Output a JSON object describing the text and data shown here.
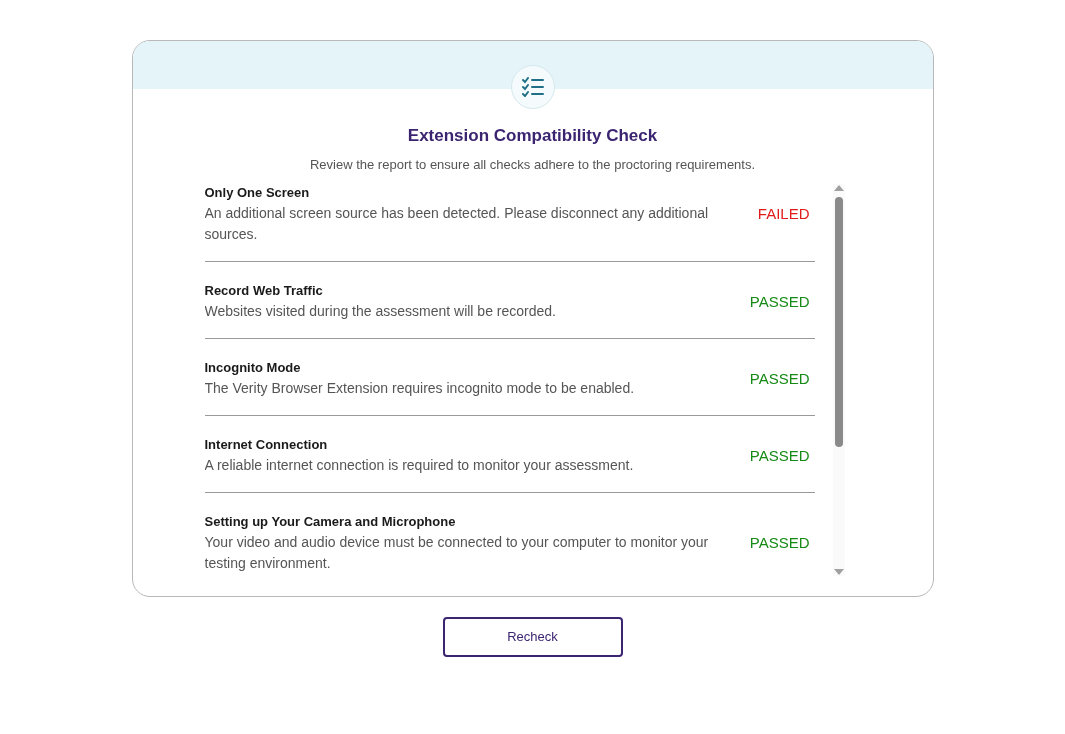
{
  "dialog": {
    "title": "Extension Compatibility Check",
    "subtitle": "Review the report to ensure all checks adhere to the proctoring requirements."
  },
  "checks": [
    {
      "title": "Only One Screen",
      "description": "An additional screen source has been detected. Please disconnect any additional sources.",
      "status": "FAILED",
      "passed": false
    },
    {
      "title": "Record Web Traffic",
      "description": "Websites visited during the assessment will be recorded.",
      "status": "PASSED",
      "passed": true
    },
    {
      "title": "Incognito Mode",
      "description": "The Verity Browser Extension requires incognito mode to be enabled.",
      "status": "PASSED",
      "passed": true
    },
    {
      "title": "Internet Connection",
      "description": "A reliable internet connection is required to monitor your assessment.",
      "status": "PASSED",
      "passed": true
    },
    {
      "title": "Setting up Your Camera and Microphone",
      "description": "Your video and audio device must be connected to your computer to monitor your testing environment.",
      "status": "PASSED",
      "passed": true
    }
  ],
  "button": "Recheck"
}
